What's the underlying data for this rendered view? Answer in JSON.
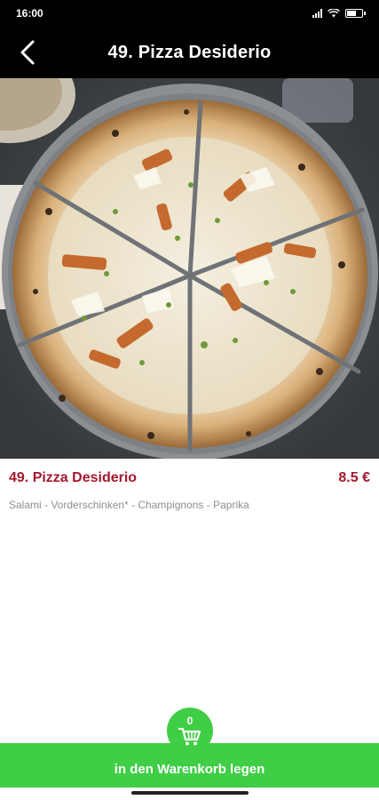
{
  "status_bar": {
    "time": "16:00",
    "icons": [
      "signal-icon",
      "wifi-icon",
      "battery-icon"
    ]
  },
  "header": {
    "back_icon": "chevron-left-icon",
    "title": "49. Pizza Desiderio"
  },
  "product": {
    "name": "49. Pizza Desiderio",
    "price": "8.5 €",
    "description": "Salami - Vorderschinken* - Champignons - Paprika"
  },
  "cart": {
    "count": "0",
    "icon": "shopping-cart-icon",
    "button_label": "in den Warenkorb legen"
  },
  "colors": {
    "header_bg": "#000000",
    "accent_red": "#a3182f",
    "cart_green": "#3fce45",
    "description_gray": "#8f8f8f"
  }
}
